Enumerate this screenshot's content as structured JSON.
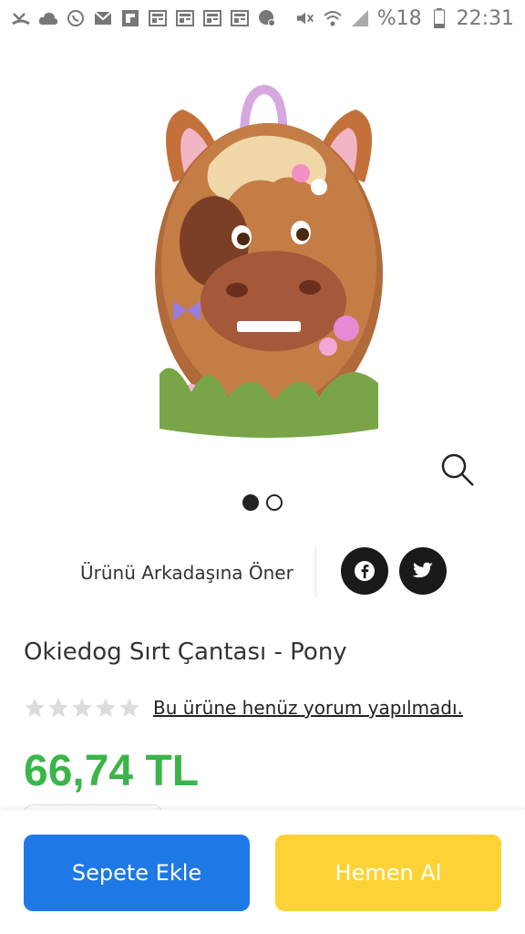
{
  "status_bar": {
    "battery": "%18",
    "time": "22:31"
  },
  "product": {
    "title": "Okiedog Sırt Çantası - Pony",
    "price": "66,74 TL",
    "rating_stars": 0,
    "review_text": "Bu ürüne henüz yorum yapılmadı.",
    "gallery_dots": 2,
    "gallery_active": 0
  },
  "share": {
    "label": "Ürünü Arkadaşına Öner"
  },
  "actions": {
    "add_to_cart": "Sepete Ekle",
    "buy_now": "Hemen Al"
  },
  "colors": {
    "price": "#3bb54a",
    "cart_button": "#1e78e6",
    "buy_button": "#fdd235"
  }
}
